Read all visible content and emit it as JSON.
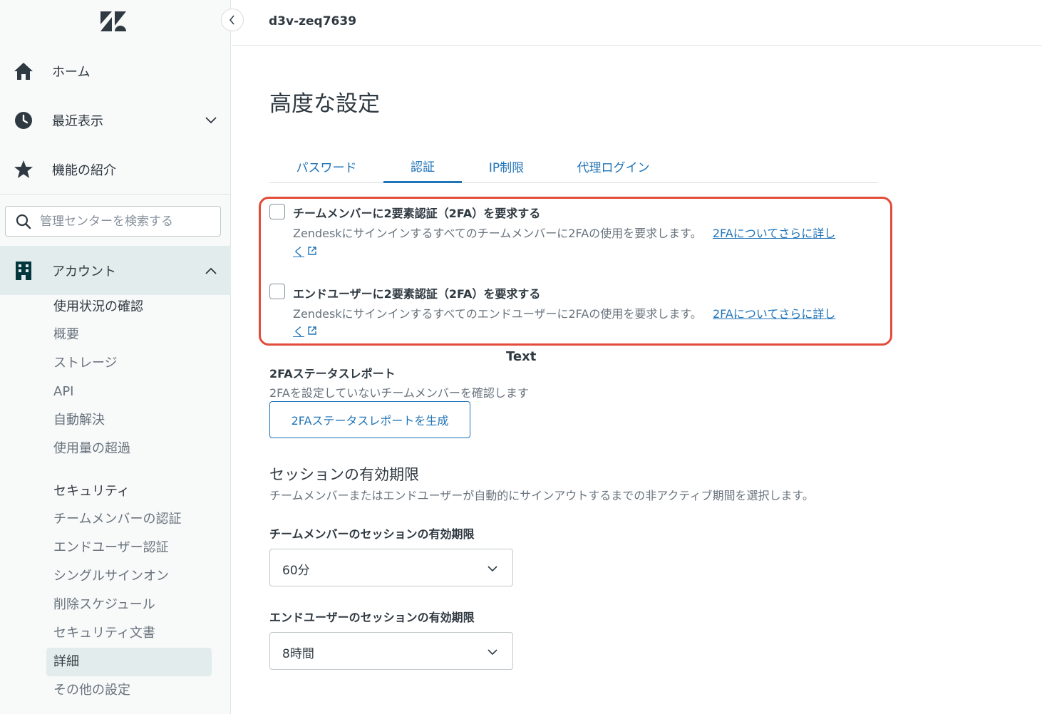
{
  "app": {
    "workspace": "d3v-zeq7639",
    "brand_color": "#1f73b7",
    "accent_highlight": "#e34b3a"
  },
  "sidebar": {
    "nav": [
      {
        "label": "ホーム",
        "icon": "home-icon"
      },
      {
        "label": "最近表示",
        "icon": "clock-icon"
      },
      {
        "label": "機能の紹介",
        "icon": "star-icon"
      }
    ],
    "search": {
      "placeholder": "管理センターを検索する"
    },
    "account": {
      "label": "アカウント",
      "icon": "building-icon"
    },
    "account_items": [
      {
        "label": "使用状況の確認"
      },
      {
        "label": "概要"
      },
      {
        "label": "ストレージ"
      },
      {
        "label": "API"
      },
      {
        "label": "自動解決"
      },
      {
        "label": "使用量の超過"
      }
    ],
    "security_header": "セキュリティ",
    "security_items": [
      {
        "label": "チームメンバーの認証"
      },
      {
        "label": "エンドユーザー認証"
      },
      {
        "label": "シングルサインオン"
      },
      {
        "label": "削除スケジュール"
      },
      {
        "label": "セキュリティ文書"
      },
      {
        "label": "詳細"
      },
      {
        "label": "その他の設定"
      }
    ]
  },
  "main": {
    "title": "高度な設定",
    "tabs": [
      {
        "label": "パスワード"
      },
      {
        "label": "認証"
      },
      {
        "label": "IP制限"
      },
      {
        "label": "代理ログイン"
      }
    ],
    "twofa_team": {
      "label": "チームメンバーに2要素認証（2FA）を要求する",
      "description": "Zendeskにサインインするすべてのチームメンバーに2FAの使用を要求します。",
      "link_line1": "2FAについてさらに詳し",
      "link_line2": "く",
      "checked": false
    },
    "twofa_end": {
      "label": "エンドユーザーに2要素認証（2FA）を要求する",
      "description": "Zendeskにサインインするすべてのエンドユーザーに2FAの使用を要求します。",
      "link_line1": "2FAについてさらに詳し",
      "link_line2": "く",
      "checked": false
    },
    "annotation": "Text",
    "report": {
      "title": "2FAステータスレポート",
      "description": "2FAを設定していないチームメンバーを確認します",
      "button": "2FAステータスレポートを生成"
    },
    "session": {
      "title": "セッションの有効期限",
      "description": "チームメンバーまたはエンドユーザーが自動的にサインアウトするまでの非アクティブ期間を選択します。",
      "team_label": "チームメンバーのセッションの有効期限",
      "team_value": "60分",
      "end_label": "エンドユーザーのセッションの有効期限",
      "end_value": "8時間"
    }
  }
}
